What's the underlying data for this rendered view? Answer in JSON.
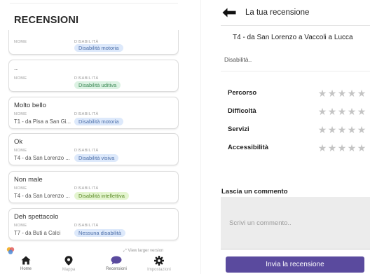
{
  "left": {
    "title": "RECENSIONI",
    "field_labels": {
      "nome": "NOME",
      "disabilita": "DISABILITÀ"
    },
    "reviews": [
      {
        "title": "",
        "route": "",
        "disability": "Disabilità motoria",
        "pill_color": "blue"
      },
      {
        "title": "..",
        "route": "",
        "disability": "Disabilità uditiva",
        "pill_color": "green"
      },
      {
        "title": "Molto bello",
        "route": "T1 - da Pisa a San Gi...",
        "disability": "Disabilità motoria",
        "pill_color": "blue"
      },
      {
        "title": "Ok",
        "route": "T4 - da San Lorenzo ...",
        "disability": "Disabilità visiva",
        "pill_color": "blue"
      },
      {
        "title": "Non male",
        "route": "T4 - da San Lorenzo ...",
        "disability": "Disabilità intellettiva",
        "pill_color": "lgreen"
      },
      {
        "title": "Deh spettacolo",
        "route": "T7 - da Buti a Calci",
        "disability": "Nessuna disabilità",
        "pill_color": "blue"
      }
    ],
    "view_larger": "View larger version",
    "nav": [
      {
        "label": "Home",
        "icon": "home-icon"
      },
      {
        "label": "Mappa",
        "icon": "map-pin-icon"
      },
      {
        "label": "Recensioni",
        "icon": "chat-bubble-icon",
        "active": true
      },
      {
        "label": "Impostazioni",
        "icon": "gear-icon"
      }
    ],
    "colors": {
      "nav_active": "#5a4a9e",
      "nav_icon": "#1f1f1f"
    }
  },
  "right": {
    "title": "La tua recensione",
    "route": "T4 - da San Lorenzo a Vaccoli a Lucca",
    "disability_placeholder": "Disabilità..",
    "ratings": [
      {
        "label": "Percorso",
        "stars": 0,
        "max": 5
      },
      {
        "label": "Difficoltà",
        "stars": 0,
        "max": 5
      },
      {
        "label": "Servizi",
        "stars": 0,
        "max": 5
      },
      {
        "label": "Accessibilità",
        "stars": 0,
        "max": 5
      }
    ],
    "comment_label": "Lascia un commento",
    "comment_placeholder": "Scrivi un commento..",
    "submit_label": "Invia la recensione",
    "colors": {
      "submit_bg": "#5a4a9e",
      "star_empty": "#c4c4c4"
    }
  }
}
